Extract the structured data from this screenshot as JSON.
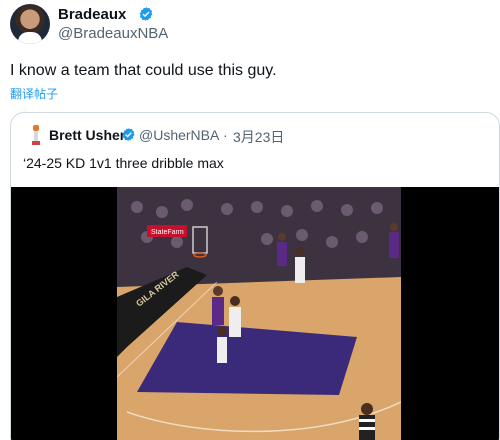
{
  "tweet": {
    "author_name": "Bradeaux",
    "handle": "@BradeauxNBA",
    "text": "I know a team that could use this guy.",
    "translate_label": "翻译帖子"
  },
  "quote": {
    "author_name": "Brett Usher",
    "handle": "@UsherNBA",
    "separator": "·",
    "date": "3月23日",
    "text": "‘24-25 KD 1v1 three dribble max"
  },
  "video": {
    "court_text": "GILA RIVER",
    "ad_text": "StateFarm"
  },
  "colors": {
    "verified": "#1d9bf0",
    "link": "#1d9bf0",
    "paint": "#3b2a7a",
    "court": "#d9a56a"
  }
}
